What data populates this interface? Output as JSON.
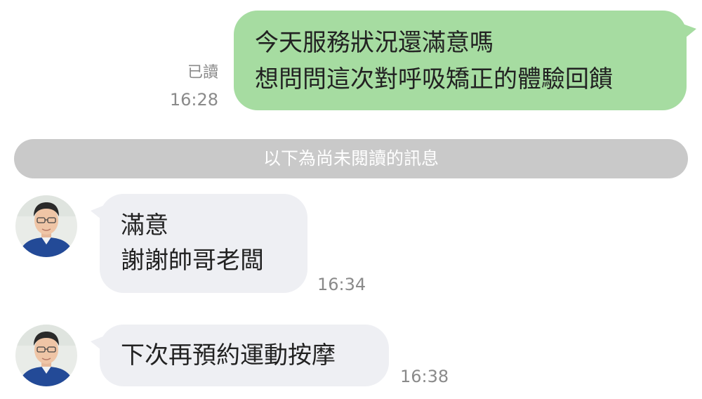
{
  "outgoing": {
    "lines": [
      "今天服務狀況還滿意嗎",
      "想問問這次對呼吸矯正的體驗回饋"
    ],
    "read_label": "已讀",
    "time": "16:28"
  },
  "unread_divider": "以下為尚未閱讀的訊息",
  "incoming": [
    {
      "lines": [
        "滿意",
        "謝謝帥哥老闆"
      ],
      "time": "16:34"
    },
    {
      "lines": [
        "下次再預約運動按摩"
      ],
      "time": "16:38"
    }
  ],
  "colors": {
    "outgoing_bubble": "#a6dca1",
    "incoming_bubble": "#eeeff3",
    "divider": "#c9c9c9",
    "meta_text": "#8a8a8a"
  }
}
